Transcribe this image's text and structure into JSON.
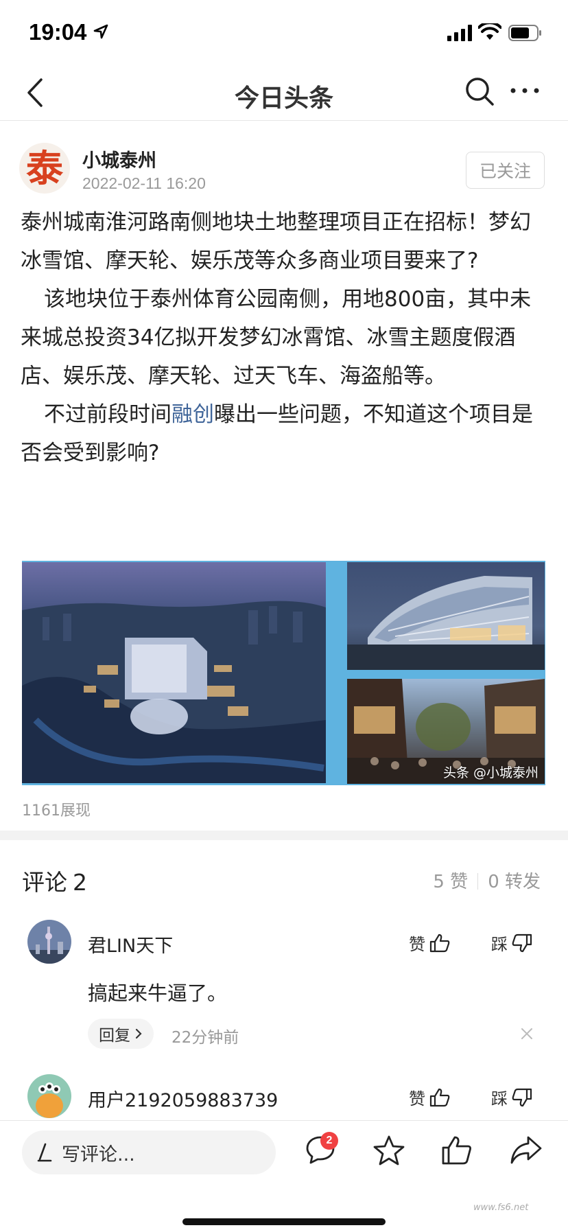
{
  "status_bar": {
    "time": "19:04"
  },
  "nav": {
    "title": "今日头条"
  },
  "author": {
    "avatar_char": "泰",
    "name": "小城泰州",
    "datetime": "2022-02-11 16:20",
    "follow_label": "已关注"
  },
  "article": {
    "title": "泰州城南淮河路南侧地块土地整理项目正在招标！梦幻冰雪馆、摩天轮、娱乐茂等众多商业项目要来了?",
    "para1": "该地块位于泰州体育公园南侧，用地800亩，其中未来城总投资34亿拟开发梦幻冰霄馆、冰雪主题度假酒店、娱乐茂、摩天轮、过天飞车、海盗船等。",
    "para2_pre": "不过前段时间",
    "para2_link": "融创",
    "para2_post": "曝出一些问题，不知道这个项目是否会受到影响?",
    "image_watermark": "头条 @小城泰州",
    "views": "1161展现"
  },
  "comments": {
    "title": "评论",
    "count": "2",
    "likes": "5 赞",
    "shares": "0 转发",
    "like_label": "赞",
    "dislike_label": "踩",
    "items": [
      {
        "name": "君LIN天下",
        "text": "搞起来牛逼了。",
        "reply_label": "回复",
        "time": "22分钟前"
      },
      {
        "name": "用户2192059883739"
      }
    ]
  },
  "bottom_bar": {
    "write_placeholder": "写评论...",
    "comment_badge": "2"
  },
  "corner_mark": "www.fs6.net",
  "colors": {
    "accent_red": "#f04142",
    "link_blue": "#406599",
    "muted": "#999999"
  }
}
